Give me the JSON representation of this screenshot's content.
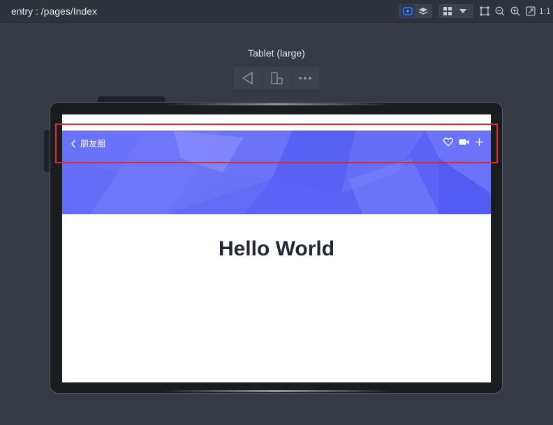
{
  "toolbar": {
    "path": "entry : /pages/Index",
    "ratio_label": "1:1"
  },
  "device": {
    "label": "Tablet (large)"
  },
  "app": {
    "back_label": "朋友圈",
    "hello_text": "Hello World",
    "banner_color": "#5a63f5"
  },
  "colors": {
    "highlight": "#e0272e",
    "accent": "#3a8bff"
  }
}
